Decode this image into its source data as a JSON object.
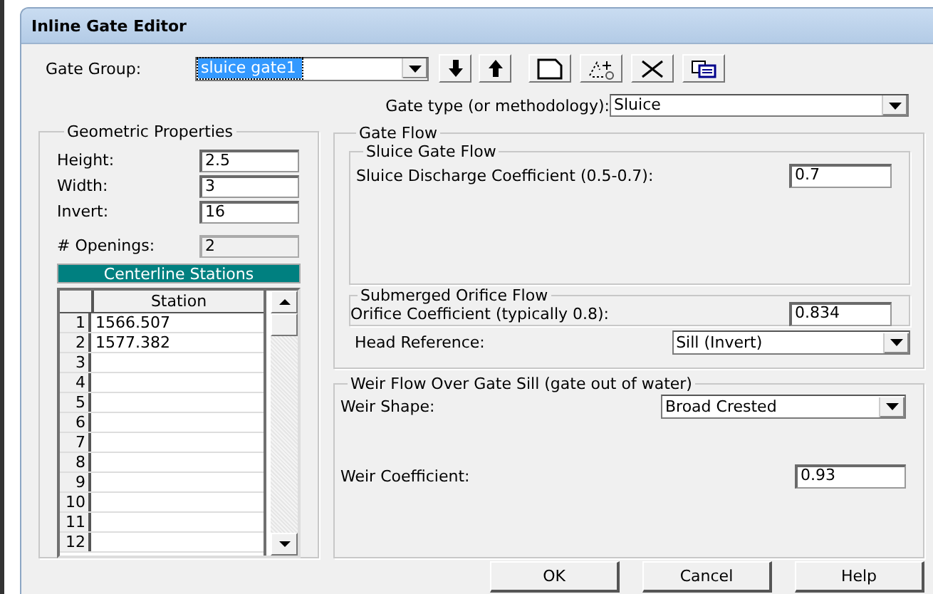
{
  "window": {
    "title": "Inline Gate Editor"
  },
  "gate_group": {
    "label": "Gate Group:",
    "value": "sluice gate1",
    "selected": true
  },
  "gate_type": {
    "label": "Gate type (or methodology):",
    "value": "Sluice"
  },
  "geometric": {
    "title": "Geometric Properties",
    "fields": [
      {
        "label": "Height:",
        "value": "2.5",
        "disabled": false
      },
      {
        "label": "Width:",
        "value": "3",
        "disabled": false
      },
      {
        "label": "Invert:",
        "value": "16",
        "disabled": false
      },
      {
        "label": "# Openings:",
        "value": "2",
        "disabled": true
      }
    ],
    "stations": {
      "title": "Centerline Stations",
      "column": "Station",
      "rows": [
        {
          "index": "1",
          "value": "1566.507"
        },
        {
          "index": "2",
          "value": "1577.382"
        },
        {
          "index": "3"
        },
        {
          "index": "4"
        },
        {
          "index": "5"
        },
        {
          "index": "6"
        },
        {
          "index": "7"
        },
        {
          "index": "8"
        },
        {
          "index": "9"
        },
        {
          "index": "10"
        },
        {
          "index": "11"
        },
        {
          "index": "12"
        }
      ]
    }
  },
  "gate_flow": {
    "title": "Gate Flow",
    "sluice": {
      "title": "Sluice Gate Flow",
      "label": "Sluice Discharge Coefficient (0.5-0.7):",
      "value": "0.7"
    },
    "orifice": {
      "title": "Submerged Orifice Flow",
      "label": "Orifice Coefficient (typically 0.8):",
      "value": "0.834"
    },
    "head_reference": {
      "label": "Head Reference:",
      "value": "Sill (Invert)"
    }
  },
  "weir": {
    "title": "Weir Flow Over Gate Sill (gate out of water)",
    "shape": {
      "label": "Weir Shape:",
      "value": "Broad Crested"
    },
    "coefficient": {
      "label": "Weir Coefficient:",
      "value": "0.93"
    }
  },
  "buttons": [
    "OK",
    "Cancel",
    "Help"
  ]
}
